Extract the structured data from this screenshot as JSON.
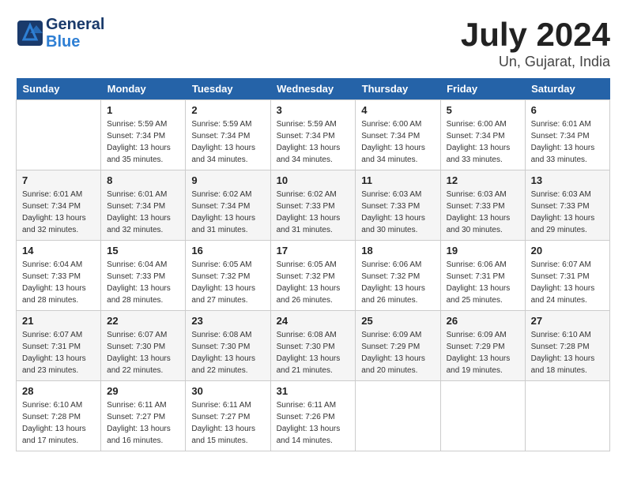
{
  "header": {
    "logo_line1": "General",
    "logo_line2": "Blue",
    "month": "July 2024",
    "location": "Un, Gujarat, India"
  },
  "weekdays": [
    "Sunday",
    "Monday",
    "Tuesday",
    "Wednesday",
    "Thursday",
    "Friday",
    "Saturday"
  ],
  "weeks": [
    [
      {
        "day": "",
        "info": ""
      },
      {
        "day": "1",
        "info": "Sunrise: 5:59 AM\nSunset: 7:34 PM\nDaylight: 13 hours\nand 35 minutes."
      },
      {
        "day": "2",
        "info": "Sunrise: 5:59 AM\nSunset: 7:34 PM\nDaylight: 13 hours\nand 34 minutes."
      },
      {
        "day": "3",
        "info": "Sunrise: 5:59 AM\nSunset: 7:34 PM\nDaylight: 13 hours\nand 34 minutes."
      },
      {
        "day": "4",
        "info": "Sunrise: 6:00 AM\nSunset: 7:34 PM\nDaylight: 13 hours\nand 34 minutes."
      },
      {
        "day": "5",
        "info": "Sunrise: 6:00 AM\nSunset: 7:34 PM\nDaylight: 13 hours\nand 33 minutes."
      },
      {
        "day": "6",
        "info": "Sunrise: 6:01 AM\nSunset: 7:34 PM\nDaylight: 13 hours\nand 33 minutes."
      }
    ],
    [
      {
        "day": "7",
        "info": "Sunrise: 6:01 AM\nSunset: 7:34 PM\nDaylight: 13 hours\nand 32 minutes."
      },
      {
        "day": "8",
        "info": "Sunrise: 6:01 AM\nSunset: 7:34 PM\nDaylight: 13 hours\nand 32 minutes."
      },
      {
        "day": "9",
        "info": "Sunrise: 6:02 AM\nSunset: 7:34 PM\nDaylight: 13 hours\nand 31 minutes."
      },
      {
        "day": "10",
        "info": "Sunrise: 6:02 AM\nSunset: 7:33 PM\nDaylight: 13 hours\nand 31 minutes."
      },
      {
        "day": "11",
        "info": "Sunrise: 6:03 AM\nSunset: 7:33 PM\nDaylight: 13 hours\nand 30 minutes."
      },
      {
        "day": "12",
        "info": "Sunrise: 6:03 AM\nSunset: 7:33 PM\nDaylight: 13 hours\nand 30 minutes."
      },
      {
        "day": "13",
        "info": "Sunrise: 6:03 AM\nSunset: 7:33 PM\nDaylight: 13 hours\nand 29 minutes."
      }
    ],
    [
      {
        "day": "14",
        "info": "Sunrise: 6:04 AM\nSunset: 7:33 PM\nDaylight: 13 hours\nand 28 minutes."
      },
      {
        "day": "15",
        "info": "Sunrise: 6:04 AM\nSunset: 7:33 PM\nDaylight: 13 hours\nand 28 minutes."
      },
      {
        "day": "16",
        "info": "Sunrise: 6:05 AM\nSunset: 7:32 PM\nDaylight: 13 hours\nand 27 minutes."
      },
      {
        "day": "17",
        "info": "Sunrise: 6:05 AM\nSunset: 7:32 PM\nDaylight: 13 hours\nand 26 minutes."
      },
      {
        "day": "18",
        "info": "Sunrise: 6:06 AM\nSunset: 7:32 PM\nDaylight: 13 hours\nand 26 minutes."
      },
      {
        "day": "19",
        "info": "Sunrise: 6:06 AM\nSunset: 7:31 PM\nDaylight: 13 hours\nand 25 minutes."
      },
      {
        "day": "20",
        "info": "Sunrise: 6:07 AM\nSunset: 7:31 PM\nDaylight: 13 hours\nand 24 minutes."
      }
    ],
    [
      {
        "day": "21",
        "info": "Sunrise: 6:07 AM\nSunset: 7:31 PM\nDaylight: 13 hours\nand 23 minutes."
      },
      {
        "day": "22",
        "info": "Sunrise: 6:07 AM\nSunset: 7:30 PM\nDaylight: 13 hours\nand 22 minutes."
      },
      {
        "day": "23",
        "info": "Sunrise: 6:08 AM\nSunset: 7:30 PM\nDaylight: 13 hours\nand 22 minutes."
      },
      {
        "day": "24",
        "info": "Sunrise: 6:08 AM\nSunset: 7:30 PM\nDaylight: 13 hours\nand 21 minutes."
      },
      {
        "day": "25",
        "info": "Sunrise: 6:09 AM\nSunset: 7:29 PM\nDaylight: 13 hours\nand 20 minutes."
      },
      {
        "day": "26",
        "info": "Sunrise: 6:09 AM\nSunset: 7:29 PM\nDaylight: 13 hours\nand 19 minutes."
      },
      {
        "day": "27",
        "info": "Sunrise: 6:10 AM\nSunset: 7:28 PM\nDaylight: 13 hours\nand 18 minutes."
      }
    ],
    [
      {
        "day": "28",
        "info": "Sunrise: 6:10 AM\nSunset: 7:28 PM\nDaylight: 13 hours\nand 17 minutes."
      },
      {
        "day": "29",
        "info": "Sunrise: 6:11 AM\nSunset: 7:27 PM\nDaylight: 13 hours\nand 16 minutes."
      },
      {
        "day": "30",
        "info": "Sunrise: 6:11 AM\nSunset: 7:27 PM\nDaylight: 13 hours\nand 15 minutes."
      },
      {
        "day": "31",
        "info": "Sunrise: 6:11 AM\nSunset: 7:26 PM\nDaylight: 13 hours\nand 14 minutes."
      },
      {
        "day": "",
        "info": ""
      },
      {
        "day": "",
        "info": ""
      },
      {
        "day": "",
        "info": ""
      }
    ]
  ]
}
